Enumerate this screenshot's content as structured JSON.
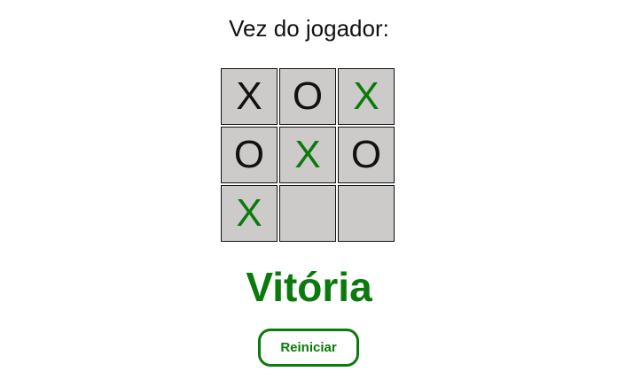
{
  "turn_label": "Vez do jogador:",
  "board": {
    "cells": [
      {
        "mark": "X",
        "color": "#111111"
      },
      {
        "mark": "O",
        "color": "#111111"
      },
      {
        "mark": "X",
        "color": "#0a7a0a"
      },
      {
        "mark": "O",
        "color": "#111111"
      },
      {
        "mark": "X",
        "color": "#0a7a0a"
      },
      {
        "mark": "O",
        "color": "#111111"
      },
      {
        "mark": "X",
        "color": "#0a7a0a"
      },
      {
        "mark": "",
        "color": "#111111"
      },
      {
        "mark": "",
        "color": "#111111"
      }
    ]
  },
  "result_text": "Vitória",
  "restart_label": "Reiniciar",
  "colors": {
    "accent": "#0a7a0a",
    "text": "#111111",
    "cell_bg": "#cdcaca"
  }
}
